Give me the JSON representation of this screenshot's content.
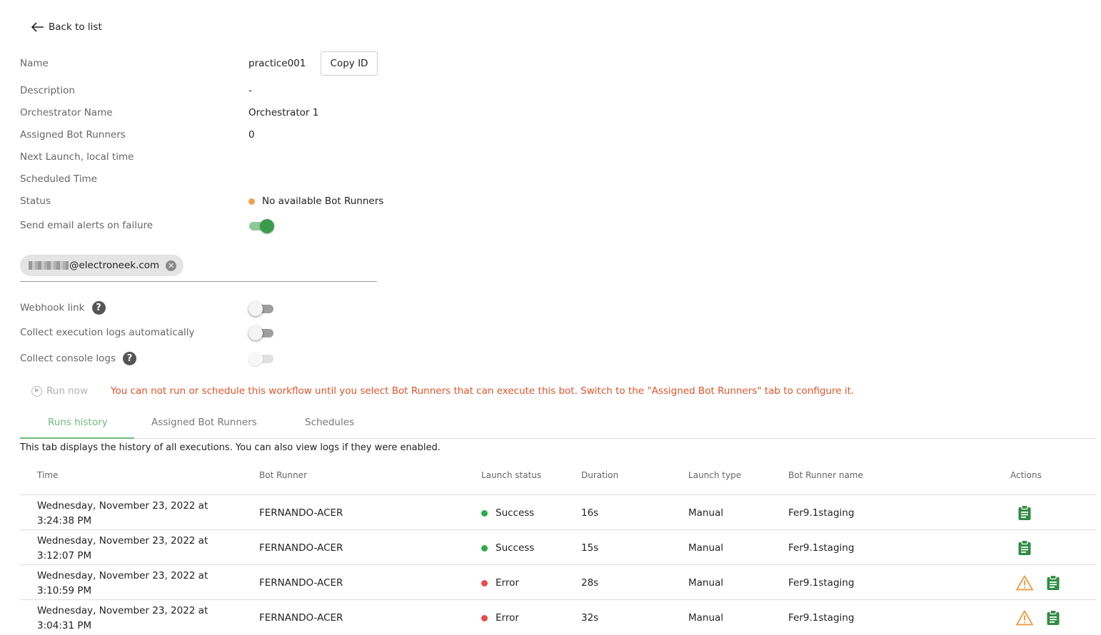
{
  "back": {
    "label": "Back to list"
  },
  "details": {
    "name_label": "Name",
    "name_value": "practice001",
    "copy_id": "Copy ID",
    "description_label": "Description",
    "description_value": "-",
    "orchestrator_label": "Orchestrator Name",
    "orchestrator_value": "Orchestrator 1",
    "assigned_label": "Assigned Bot Runners",
    "assigned_value": "0",
    "next_launch_label": "Next Launch, local time",
    "scheduled_label": "Scheduled Time",
    "status_label": "Status",
    "status_value": "No available Bot Runners",
    "email_alerts_label": "Send email alerts on failure",
    "email_alerts_on": true,
    "email_chip": "@electroneek.com",
    "webhook_label": "Webhook link",
    "webhook_on": false,
    "collect_exec_label": "Collect execution logs automatically",
    "collect_exec_on": false,
    "collect_console_label": "Collect console logs",
    "collect_console_on": false
  },
  "run_now": "Run now",
  "warning": "You can not run or schedule this workflow until you select Bot Runners that can execute this bot. Switch to the \"Assigned Bot Runners\" tab to configure it.",
  "tabs": [
    {
      "label": "Runs history",
      "active": true
    },
    {
      "label": "Assigned Bot Runners",
      "active": false
    },
    {
      "label": "Schedules",
      "active": false
    }
  ],
  "tab_description": "This tab displays the history of all executions. You can also view logs if they were enabled.",
  "table": {
    "headers": [
      "Time",
      "Bot Runner",
      "Launch status",
      "Duration",
      "Launch type",
      "Bot Runner name",
      "Actions"
    ],
    "rows": [
      {
        "time": "Wednesday, November 23, 2022 at 3:24:38 PM",
        "bot_runner": "FERNANDO-ACER",
        "status": "Success",
        "duration": "16s",
        "launch_type": "Manual",
        "runner_name": "Fer9.1staging",
        "warning": false
      },
      {
        "time": "Wednesday, November 23, 2022 at 3:12:07 PM",
        "bot_runner": "FERNANDO-ACER",
        "status": "Success",
        "duration": "15s",
        "launch_type": "Manual",
        "runner_name": "Fer9.1staging",
        "warning": false
      },
      {
        "time": "Wednesday, November 23, 2022 at 3:10:59 PM",
        "bot_runner": "FERNANDO-ACER",
        "status": "Error",
        "duration": "28s",
        "launch_type": "Manual",
        "runner_name": "Fer9.1staging",
        "warning": true
      },
      {
        "time": "Wednesday, November 23, 2022 at 3:04:31 PM",
        "bot_runner": "FERNANDO-ACER",
        "status": "Error",
        "duration": "32s",
        "launch_type": "Manual",
        "runner_name": "Fer9.1staging",
        "warning": true
      }
    ]
  },
  "colors": {
    "success": "#2eaa50",
    "error": "#e84c4c",
    "status_pending": "#f0a04b",
    "accent": "#6fba7e",
    "warning_text": "#e0542a",
    "log_icon": "#2e8b43",
    "warning_icon": "#f0a04b"
  },
  "icons": {
    "back": "arrow-left-icon",
    "help": "question-circle-icon",
    "run": "play-circle-icon",
    "chip_remove": "close-circle-icon",
    "log": "clipboard-icon",
    "warning": "warning-triangle-icon"
  }
}
